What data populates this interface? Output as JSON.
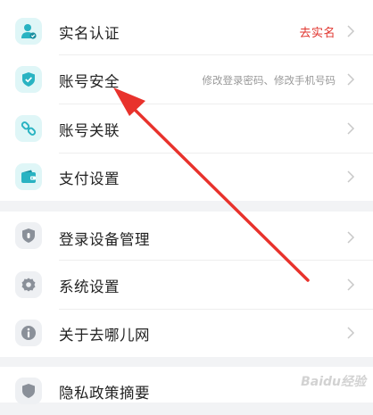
{
  "settings": {
    "items": [
      {
        "label": "实名认证",
        "icon": "verified-user-icon",
        "action": "去实名"
      },
      {
        "label": "账号安全",
        "icon": "shield-check-icon",
        "hint": "修改登录密码、修改手机号码"
      },
      {
        "label": "账号关联",
        "icon": "link-icon"
      },
      {
        "label": "支付设置",
        "icon": "wallet-icon"
      },
      {
        "label": "登录设备管理",
        "icon": "device-shield-icon"
      },
      {
        "label": "系统设置",
        "icon": "gear-icon"
      },
      {
        "label": "关于去哪儿网",
        "icon": "info-icon"
      },
      {
        "label": "隐私政策摘要",
        "icon": "privacy-shield-icon"
      }
    ]
  },
  "watermark": "Baidu经验",
  "colors": {
    "teal_accent": "#29b3c2",
    "action_red": "#e0322b",
    "arrow_red": "#e8322c",
    "page_bg": "#f2f3f5"
  }
}
